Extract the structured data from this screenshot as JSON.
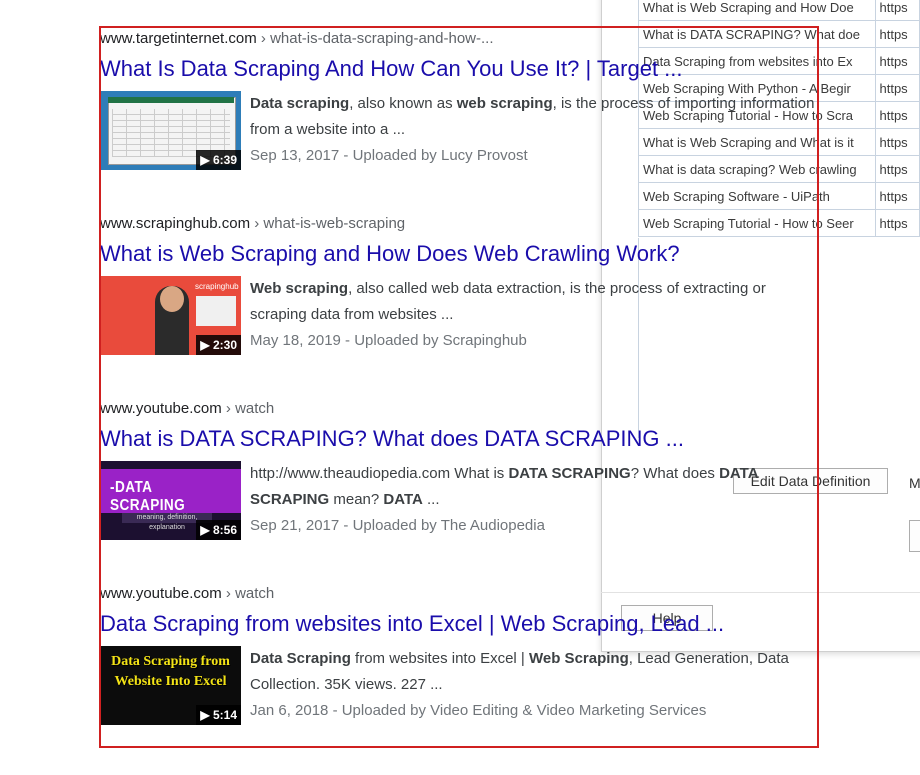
{
  "dialog": {
    "rows": [
      {
        "title": "What is Web Scraping and How Doe",
        "url": "https"
      },
      {
        "title": "What is DATA SCRAPING? What doe",
        "url": "https"
      },
      {
        "title": "Data Scraping from websites into Ex",
        "url": "https"
      },
      {
        "title": "Web Scraping With Python - A Begir",
        "url": "https"
      },
      {
        "title": "Web Scraping Tutorial - How to Scra",
        "url": "https"
      },
      {
        "title": "What is Web Scraping and What is it",
        "url": "https"
      },
      {
        "title": "What is data scraping? Web crawling",
        "url": "https"
      },
      {
        "title": "Web Scraping Software - UiPath",
        "url": "https"
      },
      {
        "title": "Web Scraping Tutorial - How to Seer",
        "url": "https"
      }
    ],
    "edit_button": "Edit Data Definition",
    "partial_letter": "M",
    "help_button": "Help"
  },
  "results": [
    {
      "domain": "www.targetinternet.com",
      "path": " › what-is-data-scraping-and-how-...",
      "title": "What Is Data Scraping And How Can You Use It? | Target ...",
      "duration": "▶ 6:39",
      "snippet_html": "<b>Data scraping</b>, also known as <b>web scraping</b>, is the process of importing information from a website into a ...",
      "meta": "Sep 13, 2017 - Uploaded by Lucy Provost"
    },
    {
      "domain": "www.scrapinghub.com",
      "path": " › what-is-web-scraping",
      "title": "What is Web Scraping and How Does Web Crawling Work?",
      "duration": "▶ 2:30",
      "snippet_html": "<b>Web scraping</b>, also called web data extraction, is the process of extracting or scraping data from websites ...",
      "meta": "May 18, 2019 - Uploaded by Scrapinghub"
    },
    {
      "domain": "www.youtube.com",
      "path": " › watch",
      "title": "What is DATA SCRAPING? What does DATA SCRAPING ...",
      "duration": "▶ 8:56",
      "snippet_html": "http://www.theaudiopedia.com What is <b>DATA SCRAPING</b>? What does <b>DATA SCRAPING</b> mean? <b>DATA</b> ...",
      "meta": "Sep 21, 2017 - Uploaded by The Audiopedia"
    },
    {
      "domain": "www.youtube.com",
      "path": " › watch",
      "title": "Data Scraping from websites into Excel | Web Scraping, Lead ...",
      "duration": "▶ 5:14",
      "snippet_html": "<b>Data Scraping</b> from websites into Excel | <b>Web Scraping</b>, Lead Generation, Data Collection. 35K views. 227 ...",
      "meta": "Jan 6, 2018 - Uploaded by Video Editing & Video Marketing Services"
    }
  ],
  "thumbs": {
    "t2_logo": "scrapinghub",
    "t3_text": "-DATA SCRAPING",
    "t3_sub": "meaning, definition, explanation",
    "t4_text": "Data Scraping from Website Into Excel"
  },
  "colors": {
    "link": "#1a0dab",
    "highlight_box": "#d02020"
  }
}
